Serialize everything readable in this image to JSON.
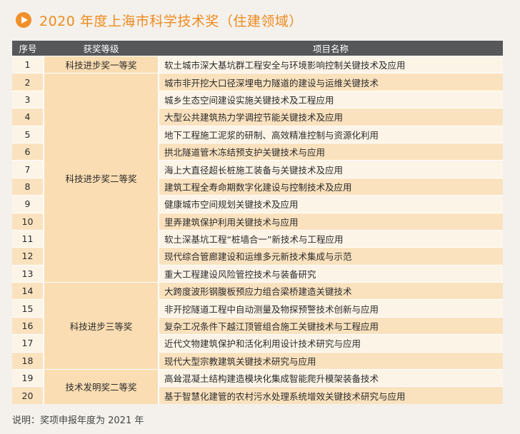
{
  "title": "2020 年度上海市科学技术奖（住建领域）",
  "icons": {
    "title_icon": "play-circle-icon"
  },
  "colors": {
    "accent": "#ee8a1f",
    "header_bg": "#555759",
    "row_light": "#fcf4e7",
    "row_dark": "#fbe2bf",
    "grade_bg": "#faddb2"
  },
  "table": {
    "headers": [
      "序号",
      "获奖等级",
      "项目名称"
    ],
    "groups": [
      {
        "grade": "科技进步奖一等奖",
        "rows": [
          {
            "no": "1",
            "name": "软土城市深大基坑群工程安全与环境影响控制关键技术及应用"
          }
        ]
      },
      {
        "grade": "科技进步奖二等奖",
        "rows": [
          {
            "no": "2",
            "name": "城市非开挖大口径深埋电力隧道的建设与运维关键技术"
          },
          {
            "no": "3",
            "name": "城乡生态空间建设实施关键技术及工程应用"
          },
          {
            "no": "4",
            "name": "大型公共建筑热力学调控节能关键技术及应用"
          },
          {
            "no": "5",
            "name": "地下工程施工泥浆的研制、高效精准控制与资源化利用"
          },
          {
            "no": "6",
            "name": "拱北隧道管木冻结预支护关键技术与应用"
          },
          {
            "no": "7",
            "name": "海上大直径超长桩施工装备与关键技术及应用"
          },
          {
            "no": "8",
            "name": "建筑工程全寿命期数字化建设与控制技术及应用"
          },
          {
            "no": "9",
            "name": "健康城市空间规划关键技术及应用"
          },
          {
            "no": "10",
            "name": "里弄建筑保护利用关键技术与应用"
          },
          {
            "no": "11",
            "name": "软土深基坑工程“桩墙合一”新技术与工程应用"
          },
          {
            "no": "12",
            "name": "现代综合管廊建设和运维多元新技术集成与示范"
          },
          {
            "no": "13",
            "name": "重大工程建设风险管控技术与装备研究"
          }
        ]
      },
      {
        "grade": "科技进步三等奖",
        "rows": [
          {
            "no": "14",
            "name": "大跨度波形钢腹板预应力组合梁桥建造关键技术"
          },
          {
            "no": "15",
            "name": "非开挖隧道工程中自动测量及物探预警技术创新与应用"
          },
          {
            "no": "16",
            "name": "复杂工况条件下越江顶管组合施工关键技术与工程应用"
          },
          {
            "no": "17",
            "name": "近代文物建筑保护和活化利用设计技术研究与应用"
          },
          {
            "no": "18",
            "name": "现代大型宗教建筑关键技术研究与应用"
          }
        ]
      },
      {
        "grade": "技术发明奖二等奖",
        "rows": [
          {
            "no": "19",
            "name": "高耸混凝土结构建造模块化集成智能爬升模架装备技术"
          },
          {
            "no": "20",
            "name": "基于智慧化建管的农村污水处理系统增效关键技术研究与应用"
          }
        ]
      }
    ]
  },
  "note": "说明：奖项申报年度为 2021 年"
}
